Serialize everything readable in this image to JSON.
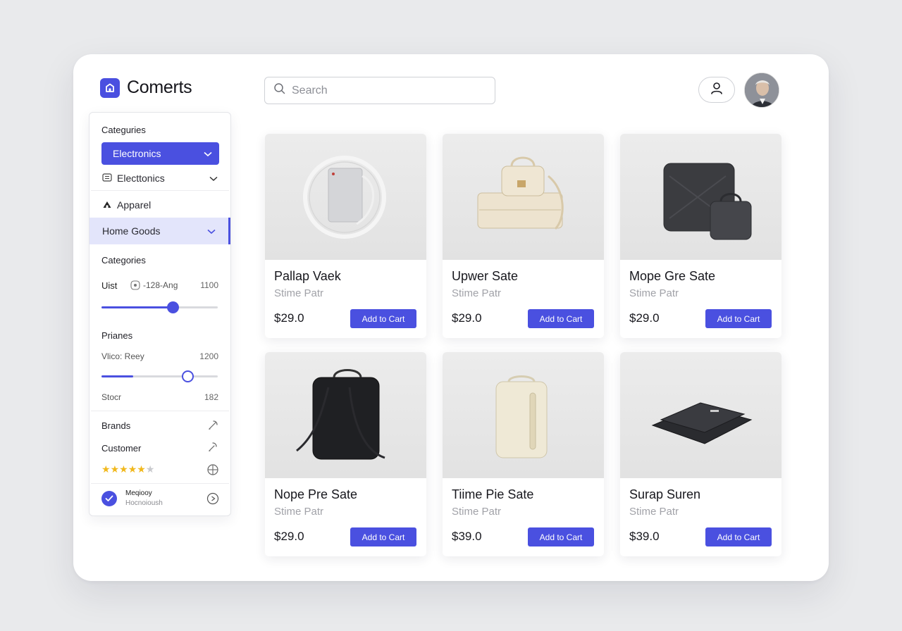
{
  "app": {
    "title": "Comerts"
  },
  "search": {
    "placeholder": "Search"
  },
  "sidebar": {
    "heading": "Categuries",
    "selected_category": "Electronics",
    "items": [
      {
        "label": "Electtonics",
        "icon": "list-icon"
      },
      {
        "label": "Apparel",
        "icon": "house-icon"
      },
      {
        "label": "Home Goods",
        "icon": ""
      }
    ],
    "filters_heading": "Categories",
    "range1": {
      "label": "Uist",
      "sublabel": "-128-Ang",
      "max_label": "1100",
      "value_fraction": 0.61
    },
    "prices_heading": "Prianes",
    "range2": {
      "label": "Vlico: Reey",
      "max_label": "1200",
      "value_fraction": 0.27,
      "thumb_fraction": 0.74
    },
    "stock": {
      "label": "Stocr",
      "value": "182"
    },
    "brands_label": "Brands",
    "customer_label": "Customer",
    "rating": {
      "filled": 5,
      "total": 6
    },
    "footer": {
      "title": "Meqiooy",
      "subtitle": "Hocnoioush"
    }
  },
  "products": [
    {
      "title": "Pallap Vaek",
      "subtitle": "Stime Patr",
      "price": "$29.0",
      "button": "Add to Cart"
    },
    {
      "title": "Upwer Sate",
      "subtitle": "Stime Patr",
      "price": "$29.0",
      "button": "Add to Cart"
    },
    {
      "title": "Mope Gre Sate",
      "subtitle": "Stime Patr",
      "price": "$29.0",
      "button": "Add to Cart"
    },
    {
      "title": "Nope Pre Sate",
      "subtitle": "Stime Patr",
      "price": "$29.0",
      "button": "Add to Cart"
    },
    {
      "title": "Tiime Pie Sate",
      "subtitle": "Stime Patr",
      "price": "$39.0",
      "button": "Add to Cart"
    },
    {
      "title": "Surap Suren",
      "subtitle": "Stime Patr",
      "price": "$39.0",
      "button": "Add to Cart"
    }
  ],
  "colors": {
    "accent": "#4a50e0",
    "accent_light": "#e3e5fb",
    "star": "#f1b81c"
  }
}
